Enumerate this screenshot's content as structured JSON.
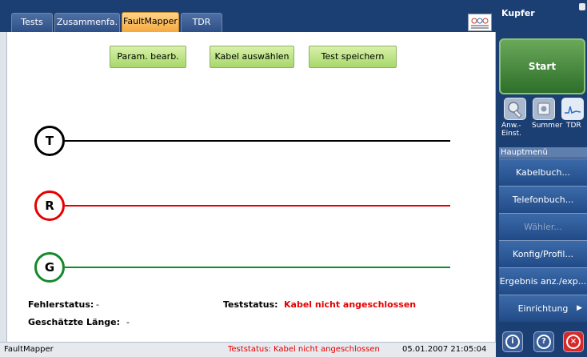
{
  "tabs": [
    {
      "label": "Tests"
    },
    {
      "label": "Zusammenfa."
    },
    {
      "label": "FaultMapper"
    },
    {
      "label": "TDR"
    }
  ],
  "toolbar": {
    "param_label": "Param. bearb.",
    "cable_label": "Kabel auswählen",
    "save_label": "Test speichern"
  },
  "wires": [
    {
      "label": "T",
      "color": "#000000"
    },
    {
      "label": "R",
      "color": "#e60000"
    },
    {
      "label": "G",
      "color": "#12892a"
    }
  ],
  "results": {
    "fehler_label": "Fehlerstatus:",
    "fehler_value": "-",
    "laenge_label": "Geschätzte Länge:",
    "laenge_value": "-",
    "teststatus_label": "Teststatus:",
    "teststatus_value": "Kabel nicht angeschlossen"
  },
  "statusbar": {
    "name": "FaultMapper",
    "status": "Teststatus: Kabel nicht angeschlossen",
    "datetime": "05.01.2007 21:05:04"
  },
  "side": {
    "title": "Kupfer",
    "start_label": "Start",
    "quick": [
      {
        "label": "Anw.- Einst.",
        "icon": "settings-wrench-icon"
      },
      {
        "label": "Summer",
        "icon": "speaker-icon"
      },
      {
        "label": "TDR",
        "icon": "tdr-graph-icon"
      }
    ],
    "menu_title": "Hauptmenü",
    "menu": [
      {
        "label": "Kabelbuch..."
      },
      {
        "label": "Telefonbuch..."
      },
      {
        "label": "Wähler..."
      },
      {
        "label": "Konfig/Profil..."
      },
      {
        "label": "Ergebnis anz./exp..."
      },
      {
        "label": "Einrichtung"
      }
    ]
  },
  "colors": {
    "accent_red": "#e60000",
    "panel_blue": "#1c3f73",
    "tab_active": "#f5a93e",
    "button_green": "#a7d76b"
  }
}
